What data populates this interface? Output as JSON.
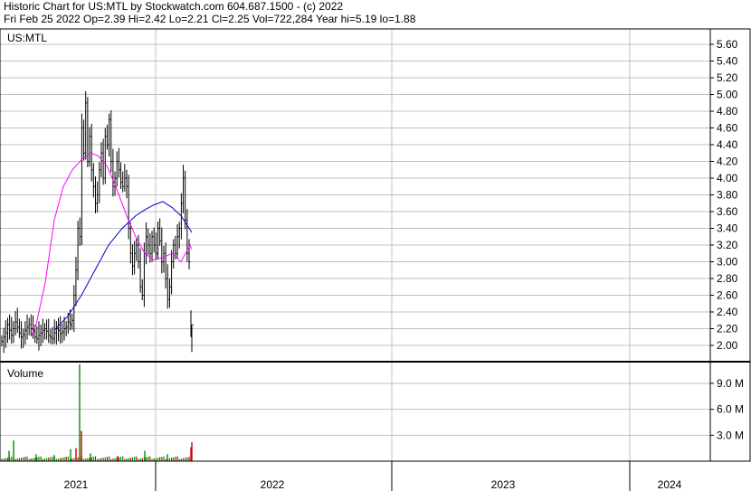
{
  "header": {
    "line1": "Historic Chart for US:MTL by Stockwatch.com 604.687.1500 - (c) 2022",
    "line2": "Fri Feb 25 2022  Op=2.39  Hi=2.42  Lo=2.21  Cl=2.25  Vol=722,284  Year hi=5.19  lo=1.88"
  },
  "chart_data": {
    "type": "line",
    "symbol_label": "US:MTL",
    "volume_label": "Volume",
    "x_labels": [
      "2021",
      "2022",
      "2023",
      "2024"
    ],
    "price_ticks": [
      "5.60",
      "5.40",
      "5.20",
      "5.00",
      "4.80",
      "4.60",
      "4.40",
      "4.20",
      "4.00",
      "3.80",
      "3.60",
      "3.40",
      "3.20",
      "3.00",
      "2.80",
      "2.60",
      "2.40",
      "2.20",
      "2.00"
    ],
    "volume_ticks": [
      "9.0 M",
      "6.0 M",
      "3.0 M"
    ],
    "price_ylim": [
      1.86,
      5.72
    ],
    "volume_ylim": [
      0,
      11.3
    ],
    "grid": true,
    "colors": {
      "price_bars": "#000000",
      "ma_short": "#ff00ff",
      "ma_long": "#0000cc",
      "volume_up": "#008800",
      "volume_down": "#cc0000",
      "grid": "#c0c0c0"
    },
    "price_closes": [
      2.05,
      2.1,
      2.15,
      2.25,
      2.18,
      2.12,
      2.2,
      2.28,
      2.22,
      2.15,
      2.1,
      2.13,
      2.18,
      2.22,
      2.25,
      2.2,
      2.16,
      2.1,
      2.08,
      2.12,
      2.15,
      2.18,
      2.2,
      2.17,
      2.12,
      2.1,
      2.08,
      2.15,
      2.2,
      2.18,
      2.14,
      2.16,
      2.2,
      2.22,
      2.28,
      2.25,
      2.3,
      2.6,
      2.9,
      3.4,
      3.3,
      4.6,
      4.3,
      4.9,
      4.2,
      4.5,
      4.1,
      3.9,
      3.7,
      3.8,
      4.1,
      4.3,
      4.0,
      4.5,
      4.4,
      4.7,
      4.2,
      3.9,
      4.0,
      4.2,
      4.1,
      3.95,
      3.9,
      4.0,
      3.9,
      3.4,
      3.1,
      2.95,
      3.1,
      3.2,
      3.0,
      2.7,
      2.6,
      3.1,
      3.3,
      3.2,
      3.1,
      3.3,
      3.2,
      3.1,
      3.4,
      3.25,
      3.0,
      3.1,
      2.8,
      2.55,
      2.7,
      3.0,
      3.2,
      3.1,
      3.3,
      3.4,
      3.7,
      4.0,
      3.5,
      3.1,
      3.0
    ],
    "tail_closes": [
      2.25,
      2.1,
      2.25
    ],
    "ma_short": [
      [
        35,
        2.12
      ],
      [
        40,
        2.25
      ],
      [
        50,
        2.75
      ],
      [
        60,
        3.5
      ],
      [
        70,
        3.9
      ],
      [
        80,
        4.1
      ],
      [
        90,
        4.22
      ],
      [
        100,
        4.3
      ],
      [
        108,
        4.27
      ],
      [
        118,
        4.15
      ],
      [
        128,
        3.9
      ],
      [
        140,
        3.55
      ],
      [
        150,
        3.3
      ],
      [
        160,
        3.1
      ],
      [
        170,
        3.02
      ],
      [
        180,
        3.05
      ],
      [
        190,
        3.1
      ],
      [
        200,
        3.0
      ],
      [
        205,
        3.1
      ],
      [
        210,
        3.2
      ],
      [
        212,
        3.15
      ]
    ],
    "ma_long": [
      [
        60,
        2.18
      ],
      [
        75,
        2.35
      ],
      [
        90,
        2.6
      ],
      [
        105,
        2.9
      ],
      [
        120,
        3.2
      ],
      [
        135,
        3.4
      ],
      [
        150,
        3.55
      ],
      [
        160,
        3.62
      ],
      [
        170,
        3.68
      ],
      [
        180,
        3.72
      ],
      [
        190,
        3.65
      ],
      [
        200,
        3.55
      ],
      [
        208,
        3.42
      ],
      [
        212,
        3.35
      ]
    ],
    "volume_spikes": [
      [
        10,
        1.2,
        "up"
      ],
      [
        15,
        2.4,
        "up"
      ],
      [
        40,
        0.8,
        "up"
      ],
      [
        60,
        0.7,
        "up"
      ],
      [
        78,
        1.4,
        "up"
      ],
      [
        84,
        1.5,
        "down"
      ],
      [
        88,
        11.2,
        "up"
      ],
      [
        90,
        3.5,
        "down"
      ],
      [
        100,
        0.9,
        "up"
      ],
      [
        130,
        0.6,
        "down"
      ],
      [
        160,
        1.2,
        "up"
      ],
      [
        185,
        0.8,
        "up"
      ],
      [
        211,
        1.6,
        "down"
      ],
      [
        212,
        2.2,
        "down"
      ]
    ]
  }
}
